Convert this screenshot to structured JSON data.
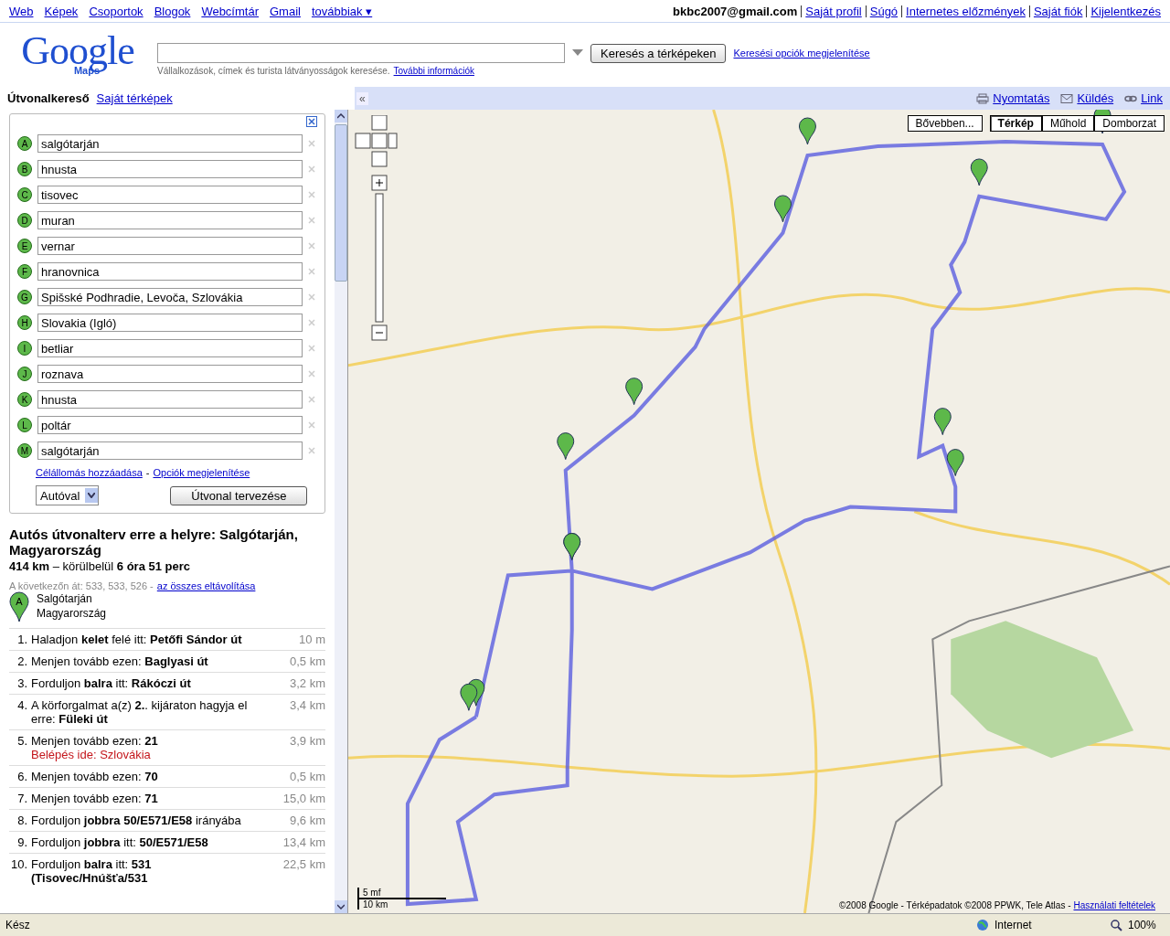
{
  "top_nav": {
    "links": [
      "Web",
      "Képek",
      "Csoportok",
      "Blogok",
      "Webcímtár",
      "Gmail"
    ],
    "more": "továbbiak ▾",
    "user": "bkbc2007@gmail.com",
    "account_links": [
      "Saját profil",
      "Súgó",
      "Internetes előzmények",
      "Saját fiók",
      "Kijelentkezés"
    ]
  },
  "header": {
    "logo": "Google",
    "logo_sub": "Maps",
    "search_hint": "Vállalkozások, címek és turista látványosságok keresése.",
    "more_info": "További információk",
    "search_button": "Keresés a térképeken",
    "options_link": "Keresési opciók megjelenítése"
  },
  "tabs": [
    {
      "label": "Útvonalkereső",
      "selected": true
    },
    {
      "label": "Saját térképek",
      "selected": false
    }
  ],
  "collapse": "«",
  "map_actions": [
    "Nyomtatás",
    "Küldés",
    "Link"
  ],
  "waypoints": [
    {
      "letter": "A",
      "value": "salgótarján"
    },
    {
      "letter": "B",
      "value": "hnusta"
    },
    {
      "letter": "C",
      "value": "tisovec"
    },
    {
      "letter": "D",
      "value": "muran"
    },
    {
      "letter": "E",
      "value": "vernar"
    },
    {
      "letter": "F",
      "value": "hranovnica"
    },
    {
      "letter": "G",
      "value": "Spišské Podhradie, Levoča, Szlovákia"
    },
    {
      "letter": "H",
      "value": "Slovakia (Igló)"
    },
    {
      "letter": "I",
      "value": "betliar"
    },
    {
      "letter": "J",
      "value": "roznava"
    },
    {
      "letter": "K",
      "value": "hnusta"
    },
    {
      "letter": "L",
      "value": "poltár"
    },
    {
      "letter": "M",
      "value": "salgótarján"
    }
  ],
  "add_destination": "Célállomás hozzáadása",
  "separator": "-",
  "show_options": "Opciók megjelenítése",
  "mode": "Autóval",
  "plan_button": "Útvonal tervezése",
  "route": {
    "title": "Autós útvonalterv erre a helyre: Salgótarján, Magyarország",
    "summary": "**414 km** – körülbelül **6 óra 51 perc**",
    "via": "A következőn át: 533, 533, 526 -",
    "remove_all": "az összes eltávolítása",
    "start_letter": "A",
    "start_name": "Salgótarján",
    "start_country": "Magyarország"
  },
  "steps": [
    {
      "number": "1.",
      "text": "Haladjon **kelet** felé itt: **Petőfi Sándor út**",
      "distance": "10 m"
    },
    {
      "number": "2.",
      "text": "Menjen tovább ezen: **Baglyasi út**",
      "distance": "0,5 km"
    },
    {
      "number": "3.",
      "text": "Forduljon **balra** itt: **Rákóczi út**",
      "distance": "3,2 km"
    },
    {
      "number": "4.",
      "text": "A körforgalmat a(z) **2.**. kijáraton hagyja el erre: **Füleki út**",
      "distance": "3,4 km"
    },
    {
      "number": "5.",
      "text": "Menjen tovább ezen: **21**",
      "distance": "3,9 km",
      "note": "Belépés ide: Szlovákia"
    },
    {
      "number": "6.",
      "text": "Menjen tovább ezen: **70**",
      "distance": "0,5 km"
    },
    {
      "number": "7.",
      "text": "Menjen tovább ezen: **71**",
      "distance": "15,0 km"
    },
    {
      "number": "8.",
      "text": "Forduljon **jobbra 50/E571/E58** irányába",
      "distance": "9,6 km"
    },
    {
      "number": "9.",
      "text": "Forduljon **jobbra** itt: **50/E571/E58**",
      "distance": "13,4 km"
    },
    {
      "number": "10.",
      "text": "Forduljon **balra** itt: **531** **(Tisovec/Hnúšťa/531**",
      "distance": "22,5 km"
    }
  ],
  "map": {
    "more_button": "Bővebben...",
    "types": [
      {
        "label": "Térkép",
        "selected": true
      },
      {
        "label": "Műhold",
        "selected": false
      },
      {
        "label": "Domborzat",
        "selected": false
      }
    ],
    "scale_top": "5 mf",
    "scale_bottom": "10 km",
    "copyright": "©2008 Google - Térképadatok ©2008 PPWK, Tele Atlas -",
    "terms": "Használati feltételek"
  },
  "status_bar": {
    "text": "Kész",
    "zone": "Internet",
    "zoom": "100%"
  }
}
